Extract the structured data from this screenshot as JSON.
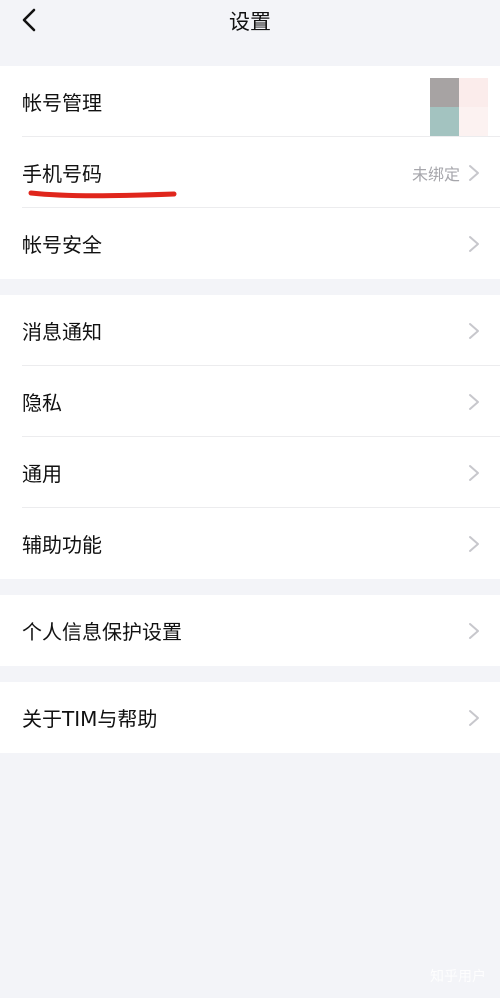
{
  "nav": {
    "title": "设置",
    "back_icon": "chevron-left-icon"
  },
  "groups": [
    [
      {
        "label": "帐号管理"
      },
      {
        "label": "手机号码",
        "value": "未绑定"
      },
      {
        "label": "帐号安全"
      }
    ],
    [
      {
        "label": "消息通知"
      },
      {
        "label": "隐私"
      },
      {
        "label": "通用"
      },
      {
        "label": "辅助功能"
      }
    ],
    [
      {
        "label": "个人信息保护设置"
      }
    ],
    [
      {
        "label": "关于TIM与帮助"
      }
    ]
  ],
  "annotation": {
    "underline_color": "#e0261c"
  },
  "watermark": "知乎用户",
  "colors": {
    "background": "#f3f4f8",
    "row_bg": "#ffffff",
    "chevron": "#c7c7cc",
    "muted_text": "#a6a6ab"
  }
}
